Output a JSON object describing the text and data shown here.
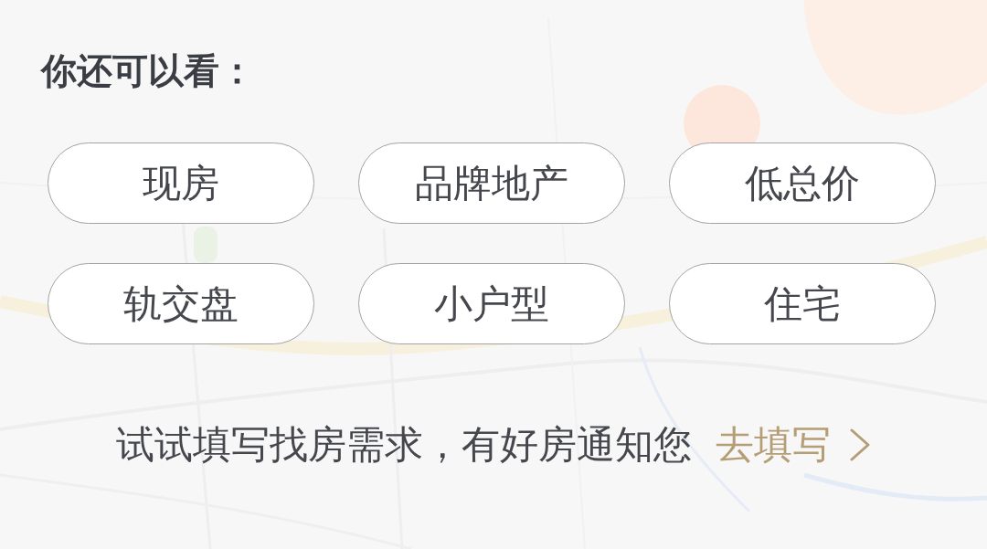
{
  "heading": "你还可以看：",
  "tags": [
    {
      "label": "现房"
    },
    {
      "label": "品牌地产"
    },
    {
      "label": "低总价"
    },
    {
      "label": "轨交盘"
    },
    {
      "label": "小户型"
    },
    {
      "label": "住宅"
    }
  ],
  "footer": {
    "prompt": "试试填写找房需求，有好房通知您",
    "link": "去填写"
  }
}
